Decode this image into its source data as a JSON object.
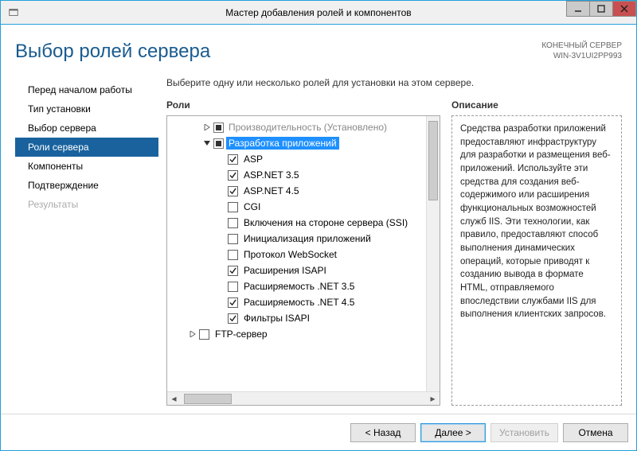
{
  "window": {
    "title": "Мастер добавления ролей и компонентов"
  },
  "header": {
    "pageTitle": "Выбор ролей сервера",
    "serverLabel": "КОНЕЧНЫЙ СЕРВЕР",
    "serverName": "WIN-3V1UI2PP993"
  },
  "nav": {
    "items": [
      {
        "label": "Перед началом работы",
        "state": "normal"
      },
      {
        "label": "Тип установки",
        "state": "normal"
      },
      {
        "label": "Выбор сервера",
        "state": "normal"
      },
      {
        "label": "Роли сервера",
        "state": "active"
      },
      {
        "label": "Компоненты",
        "state": "normal"
      },
      {
        "label": "Подтверждение",
        "state": "normal"
      },
      {
        "label": "Результаты",
        "state": "disabled"
      }
    ]
  },
  "body": {
    "instruction": "Выберите одну или несколько ролей для установки на этом сервере.",
    "rolesHeader": "Роли",
    "descHeader": "Описание",
    "tree": [
      {
        "indent": 2,
        "arrow": "right",
        "box": "indet",
        "label": "Производительность (Установлено)",
        "installed": true
      },
      {
        "indent": 2,
        "arrow": "down",
        "box": "indet",
        "label": "Разработка приложений",
        "selected": true
      },
      {
        "indent": 3,
        "checked": true,
        "label": "ASP"
      },
      {
        "indent": 3,
        "checked": true,
        "label": "ASP.NET 3.5"
      },
      {
        "indent": 3,
        "checked": true,
        "label": "ASP.NET 4.5"
      },
      {
        "indent": 3,
        "checked": false,
        "label": "CGI"
      },
      {
        "indent": 3,
        "checked": false,
        "label": "Включения на стороне сервера (SSI)"
      },
      {
        "indent": 3,
        "checked": false,
        "label": "Инициализация приложений"
      },
      {
        "indent": 3,
        "checked": false,
        "label": "Протокол WebSocket"
      },
      {
        "indent": 3,
        "checked": true,
        "label": "Расширения ISAPI"
      },
      {
        "indent": 3,
        "checked": false,
        "label": "Расширяемость .NET 3.5"
      },
      {
        "indent": 3,
        "checked": true,
        "label": "Расширяемость .NET 4.5"
      },
      {
        "indent": 3,
        "checked": true,
        "label": "Фильтры ISAPI"
      },
      {
        "indent": 1,
        "arrow": "right",
        "checked": false,
        "label": "FTP-сервер"
      }
    ],
    "description": "Средства разработки приложений предоставляют инфраструктуру для разработки и размещения веб-приложений. Используйте эти средства для создания веб-содержимого или расширения функциональных возможностей служб IIS. Эти технологии, как правило, предоставляют способ выполнения динамических операций, которые приводят к созданию вывода в формате HTML, отправляемого впоследствии службами IIS для выполнения клиентских запросов."
  },
  "footer": {
    "back": "< Назад",
    "next": "Далее >",
    "install": "Установить",
    "cancel": "Отмена"
  }
}
